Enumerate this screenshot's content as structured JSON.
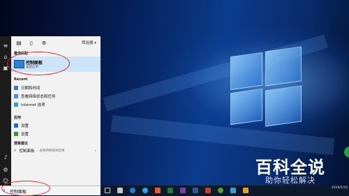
{
  "start_menu": {
    "top_tabs": [
      "all-icon",
      "docs-icon",
      "web-icon"
    ],
    "filter_label": "筛选器 ▾",
    "best_match_heading": "最佳匹配",
    "best_match": {
      "title": "控制面板",
      "subtitle": "桌面应用"
    },
    "recent_heading": "Recent",
    "recent_items": [
      "日期和时间",
      "查看网络状态和任务",
      "Internet 选项"
    ],
    "apps_heading": "应用",
    "app_items": [
      "设置",
      "设置"
    ],
    "search_suggestions_heading": "搜索建议",
    "suggestion": {
      "query": "控制面板",
      "hint": " - 查看网络搜索结果"
    },
    "search_input_value": "控制面板"
  },
  "taskbar": {
    "clock_time": "",
    "clock_date": "2016/5/16"
  },
  "watermark": {
    "title": "百科全说",
    "subtitle": "助你轻松解决"
  },
  "colors": {
    "annotation_red": "#e4262d",
    "best_match_highlight": "#cce4f7",
    "taskbar": "#0c1a2c"
  }
}
